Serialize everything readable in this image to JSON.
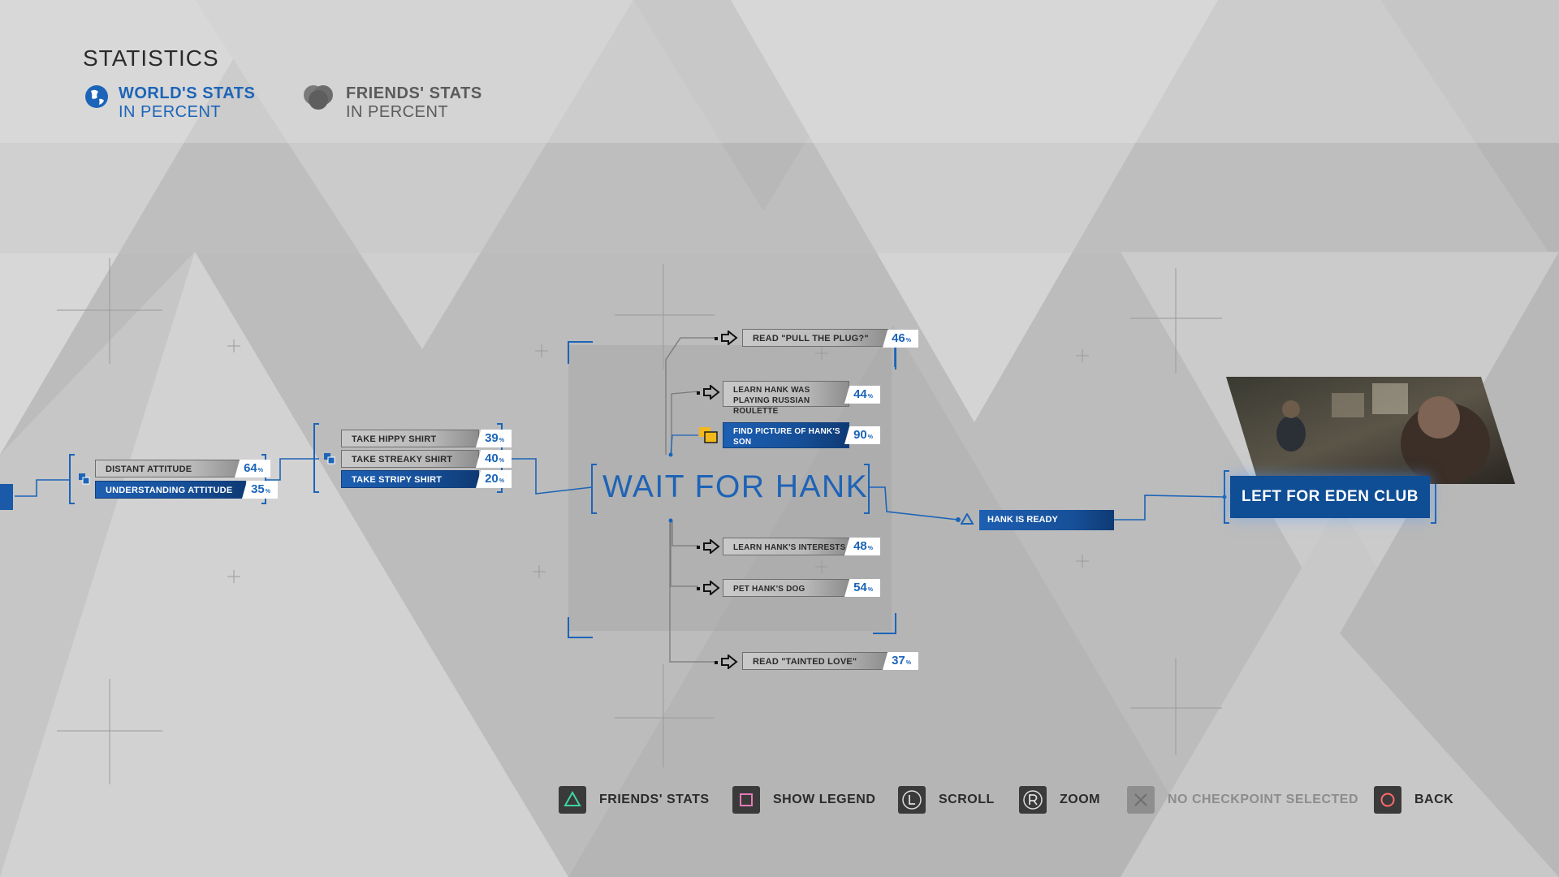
{
  "header": {
    "title": "STATISTICS",
    "world": {
      "main": "WORLD'S STATS",
      "sub": "IN PERCENT",
      "icon": "globe-icon"
    },
    "friends": {
      "main": "FRIENDS' STATS",
      "sub": "IN PERCENT",
      "icon": "friends-icon"
    }
  },
  "left_group": {
    "choices": [
      {
        "label": "DISTANT ATTITUDE",
        "percent": "64"
      },
      {
        "label": "UNDERSTANDING ATTITUDE",
        "percent": "35"
      }
    ]
  },
  "shirt_group": {
    "choices": [
      {
        "label": "TAKE HIPPY SHIRT",
        "percent": "39"
      },
      {
        "label": "TAKE STREAKY SHIRT",
        "percent": "40"
      },
      {
        "label": "TAKE STRIPY SHIRT",
        "percent": "20"
      }
    ]
  },
  "center": {
    "label": "WAIT FOR HANK"
  },
  "upper_branches": [
    {
      "label": "READ \"PULL THE PLUG?\"",
      "percent": "46"
    },
    {
      "label": "LEARN HANK WAS PLAYING RUSSIAN ROULETTE",
      "percent": "44"
    },
    {
      "label": "FIND PICTURE OF HANK'S SON",
      "percent": "90"
    }
  ],
  "lower_branches": [
    {
      "label": "LEARN HANK'S INTERESTS",
      "percent": "48"
    },
    {
      "label": "PET HANK'S DOG",
      "percent": "54"
    },
    {
      "label": "READ \"TAINTED LOVE\"",
      "percent": "37"
    }
  ],
  "percent_unit": "%",
  "right": {
    "hank_ready": "HANK IS READY",
    "outcome": "LEFT FOR EDEN CLUB"
  },
  "footer": {
    "buttons": [
      {
        "label": "FRIENDS' STATS",
        "icon": "triangle-button-icon"
      },
      {
        "label": "SHOW LEGEND",
        "icon": "square-button-icon"
      },
      {
        "label": "SCROLL",
        "icon": "left-stick-icon"
      },
      {
        "label": "ZOOM",
        "icon": "right-stick-icon"
      },
      {
        "label": "NO CHECKPOINT SELECTED",
        "icon": "cross-button-icon"
      },
      {
        "label": "BACK",
        "icon": "circle-button-icon"
      }
    ]
  },
  "colors": {
    "accent": "#1c64b8",
    "selected": "#1a5aa8",
    "background": "#bdbdbd",
    "lock": "#f2b81c"
  }
}
